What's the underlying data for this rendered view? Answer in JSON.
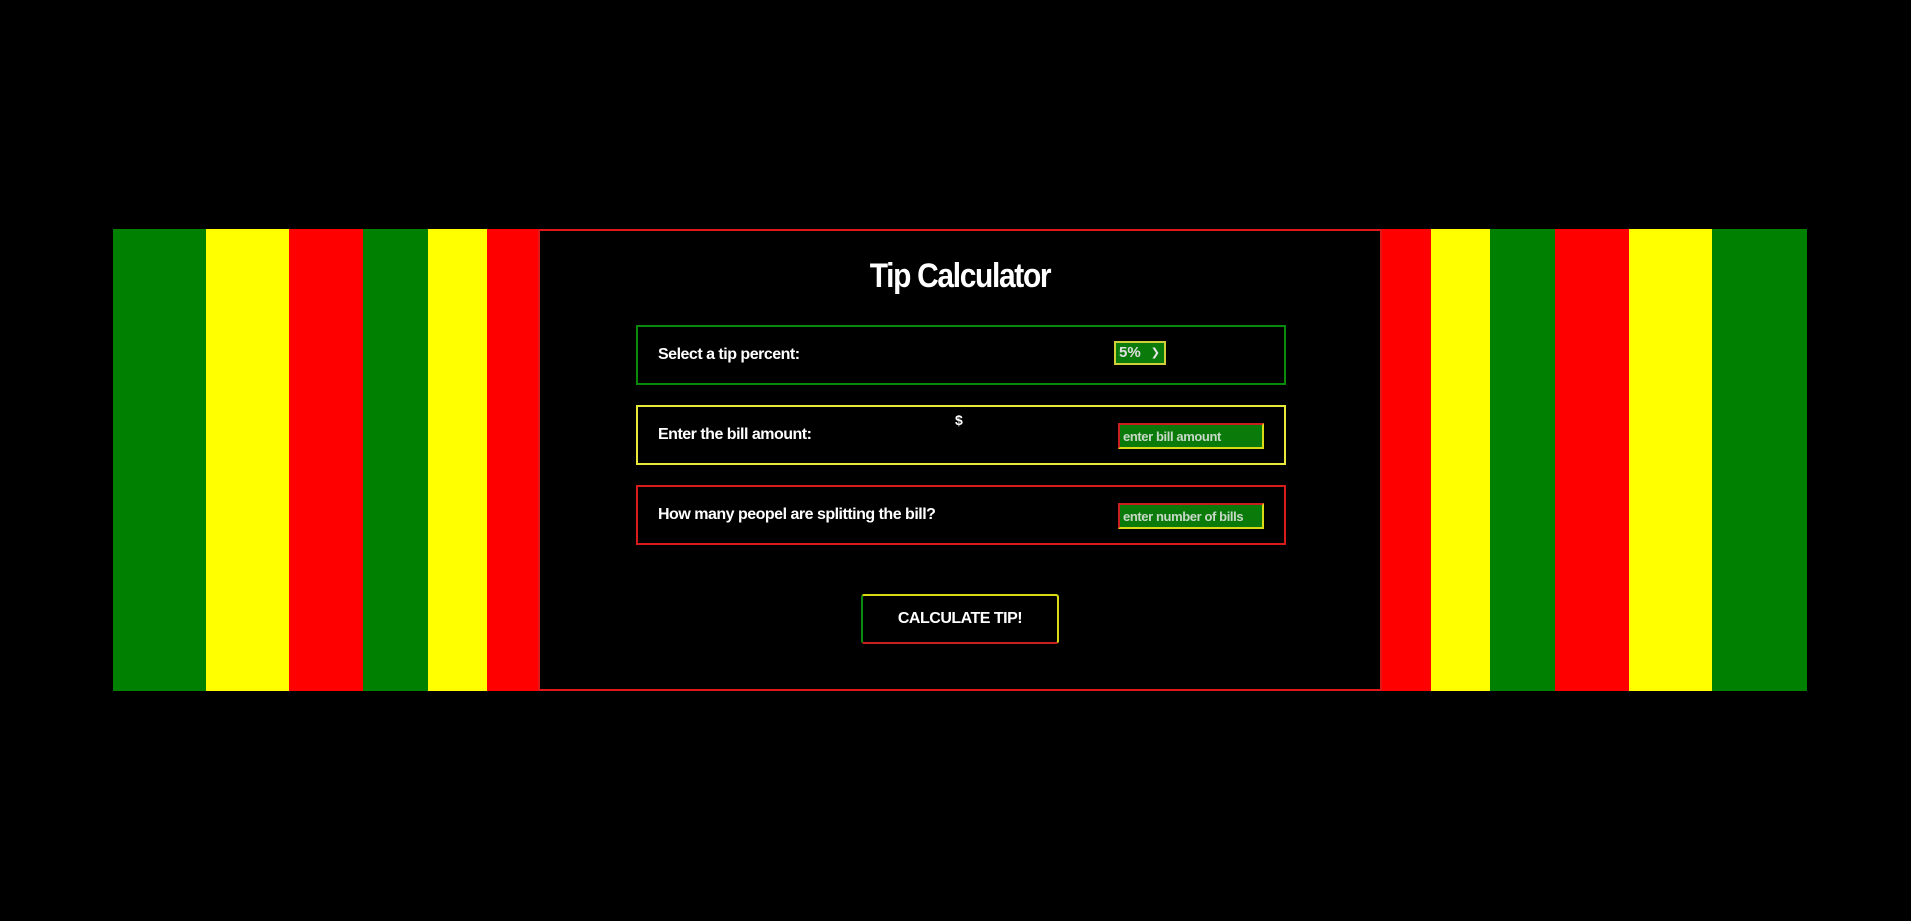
{
  "title": "Tip Calculator",
  "colors": {
    "green": "#008000",
    "yellow": "#ffff00",
    "red": "#ff0000",
    "background": "#000000"
  },
  "tip_row": {
    "label": "Select a tip percent:",
    "selected": "5%"
  },
  "bill_row": {
    "label": "Enter the bill amount:",
    "currency_symbol": "$",
    "placeholder": "enter bill amount"
  },
  "split_row": {
    "label": "How many peopel are splitting the bill?",
    "placeholder": "enter number of bills"
  },
  "button": {
    "label": "CALCULATE TIP!"
  }
}
